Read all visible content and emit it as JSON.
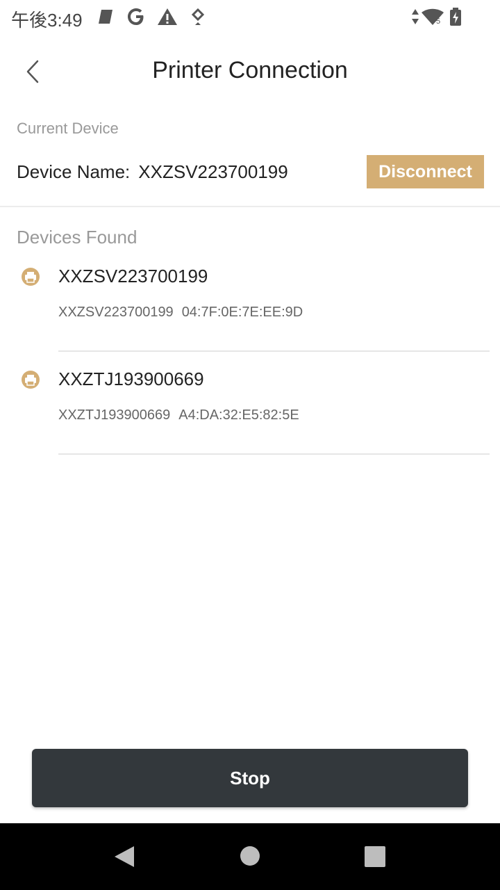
{
  "status_bar": {
    "time": "午後3:49",
    "icons": [
      "notification-icon",
      "google-icon",
      "warning-icon",
      "location-icon",
      "data-arrows-icon",
      "wifi-icon",
      "battery-charging-icon"
    ]
  },
  "header": {
    "title": "Printer Connection",
    "back_icon": "chevron-left-icon"
  },
  "current_device": {
    "section_label": "Current Device",
    "name_label": "Device Name:",
    "name_value": "XXZSV223700199",
    "disconnect_label": "Disconnect"
  },
  "devices_found": {
    "section_label": "Devices Found",
    "items": [
      {
        "name": "XXZSV223700199",
        "sub_name": "XXZSV223700199",
        "mac": "04:7F:0E:7E:EE:9D",
        "icon": "printer-icon"
      },
      {
        "name": "XXZTJ193900669",
        "sub_name": "XXZTJ193900669",
        "mac": "A4:DA:32:E5:82:5E",
        "icon": "printer-icon"
      }
    ]
  },
  "footer": {
    "stop_label": "Stop"
  },
  "nav_bar": {
    "icons": [
      "nav-back-icon",
      "nav-home-icon",
      "nav-recents-icon"
    ]
  },
  "colors": {
    "accent": "#d4ae74",
    "stop_button": "#33383c",
    "nav_bar": "#000000"
  }
}
